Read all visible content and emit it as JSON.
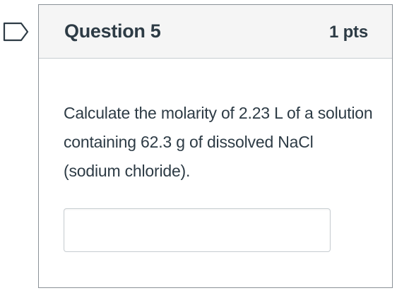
{
  "flag": {
    "icon": "bookmark-flag-icon",
    "color": "#2d3b45"
  },
  "question": {
    "title": "Question 5",
    "points": "1 pts",
    "text": "Calculate the molarity of 2.23 L of a solution containing 62.3 g of dissolved NaCl (sodium chloride).",
    "answer_value": ""
  },
  "colors": {
    "header_bg": "#f5f5f5",
    "border": "#8a9197",
    "text": "#2d3b45"
  }
}
